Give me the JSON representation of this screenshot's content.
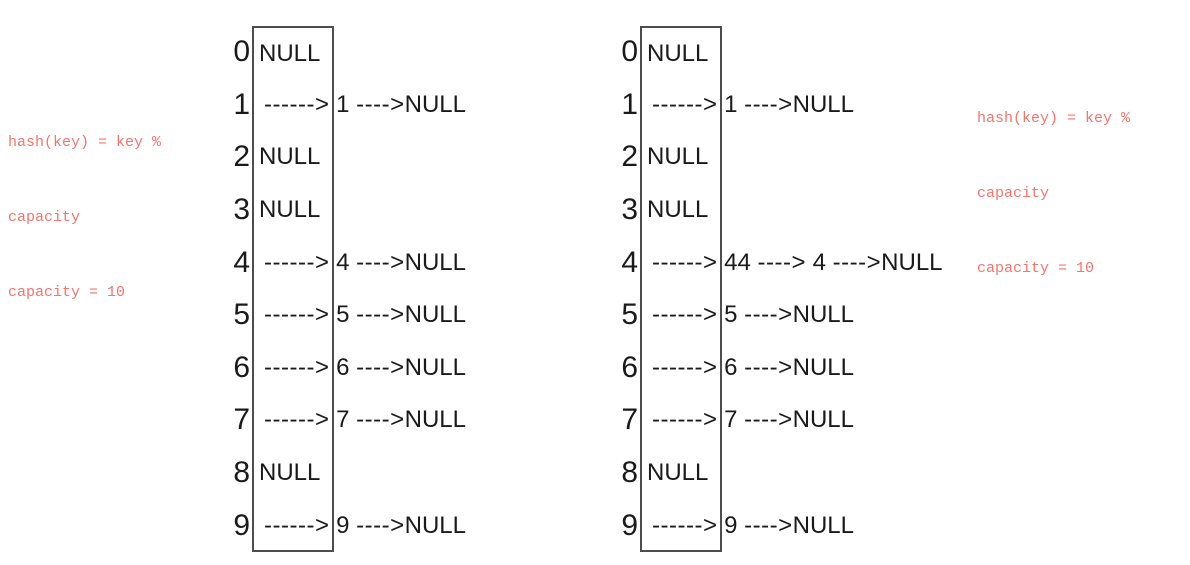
{
  "annotations": {
    "left": {
      "name": "hash-formula-note-left",
      "lines": [
        "hash(key) = key %",
        "capacity",
        "capacity = 10"
      ],
      "color": "#f4746e"
    },
    "right": {
      "name": "hash-formula-note-right",
      "lines": [
        "hash(key) = key %",
        "capacity",
        "capacity = 10"
      ],
      "color": "#f4746e"
    }
  },
  "figures": [
    {
      "id": "hash-table-before",
      "capacity": 10,
      "buckets": [
        {
          "index": "0",
          "type": "null",
          "text": "NULL"
        },
        {
          "index": "1",
          "type": "chain",
          "arrow": "------>",
          "nodes": [
            "1"
          ],
          "link": "---->",
          "tail": "NULL"
        },
        {
          "index": "2",
          "type": "null",
          "text": "NULL"
        },
        {
          "index": "3",
          "type": "null",
          "text": "NULL"
        },
        {
          "index": "4",
          "type": "chain",
          "arrow": "------>",
          "nodes": [
            "4"
          ],
          "link": "---->",
          "tail": "NULL"
        },
        {
          "index": "5",
          "type": "chain",
          "arrow": "------>",
          "nodes": [
            "5"
          ],
          "link": "---->",
          "tail": "NULL"
        },
        {
          "index": "6",
          "type": "chain",
          "arrow": "------>",
          "nodes": [
            "6"
          ],
          "link": "---->",
          "tail": "NULL"
        },
        {
          "index": "7",
          "type": "chain",
          "arrow": "------>",
          "nodes": [
            "7"
          ],
          "link": "---->",
          "tail": "NULL"
        },
        {
          "index": "8",
          "type": "null",
          "text": "NULL"
        },
        {
          "index": "9",
          "type": "chain",
          "arrow": "------>",
          "nodes": [
            "9"
          ],
          "link": "---->",
          "tail": "NULL"
        }
      ]
    },
    {
      "id": "hash-table-after",
      "capacity": 10,
      "buckets": [
        {
          "index": "0",
          "type": "null",
          "text": "NULL"
        },
        {
          "index": "1",
          "type": "chain",
          "arrow": "------>",
          "nodes": [
            "1"
          ],
          "link": "---->",
          "tail": "NULL"
        },
        {
          "index": "2",
          "type": "null",
          "text": "NULL"
        },
        {
          "index": "3",
          "type": "null",
          "text": "NULL"
        },
        {
          "index": "4",
          "type": "chain",
          "arrow": "------>",
          "nodes": [
            "44",
            "4"
          ],
          "link": "---->",
          "tail": "NULL"
        },
        {
          "index": "5",
          "type": "chain",
          "arrow": "------>",
          "nodes": [
            "5"
          ],
          "link": "---->",
          "tail": "NULL"
        },
        {
          "index": "6",
          "type": "chain",
          "arrow": "------>",
          "nodes": [
            "6"
          ],
          "link": "---->",
          "tail": "NULL"
        },
        {
          "index": "7",
          "type": "chain",
          "arrow": "------>",
          "nodes": [
            "7"
          ],
          "link": "---->",
          "tail": "NULL"
        },
        {
          "index": "8",
          "type": "null",
          "text": "NULL"
        },
        {
          "index": "9",
          "type": "chain",
          "arrow": "------>",
          "nodes": [
            "9"
          ],
          "link": "---->",
          "tail": "NULL"
        }
      ]
    }
  ]
}
